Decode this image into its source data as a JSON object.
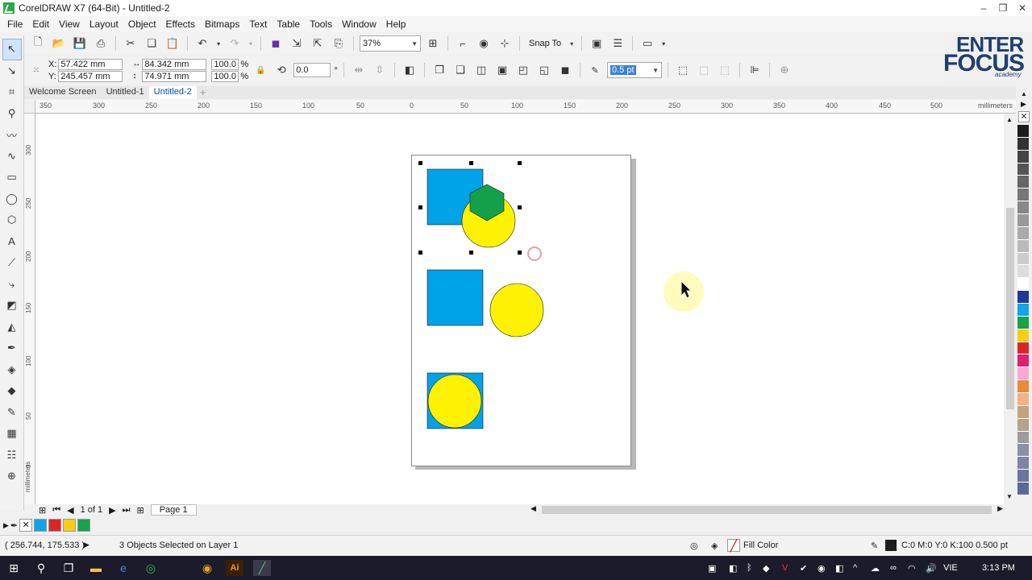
{
  "window": {
    "title": "CorelDRAW X7 (64-Bit) - Untitled-2",
    "controls": [
      "–",
      "❐",
      "✕"
    ]
  },
  "menu": [
    "File",
    "Edit",
    "View",
    "Layout",
    "Object",
    "Effects",
    "Bitmaps",
    "Text",
    "Table",
    "Tools",
    "Window",
    "Help"
  ],
  "toolbar": {
    "zoom": "37%",
    "snap_label": "Snap To"
  },
  "property_bar": {
    "x_label": "X:",
    "x_value": "57.422 mm",
    "y_label": "Y:",
    "y_value": "245.457 mm",
    "w_value": "84.342 mm",
    "h_value": "74.971 mm",
    "scale_w": "100.0",
    "scale_h": "100.0",
    "percent": "%",
    "rotation": "0.0",
    "degree": "°",
    "outline": "0.5 pt"
  },
  "logo": {
    "line1": "ENTER",
    "line2": "FOCUS",
    "line3": "academy"
  },
  "doc_tabs": [
    "Welcome Screen",
    "Untitled-1",
    "Untitled-2"
  ],
  "ruler": {
    "h_ticks": [
      "350",
      "300",
      "250",
      "200",
      "150",
      "100",
      "50",
      "0",
      "50",
      "100",
      "150",
      "200",
      "250",
      "300",
      "350",
      "400",
      "450",
      "500"
    ],
    "v_ticks": [
      "300",
      "250",
      "200",
      "150",
      "100",
      "50",
      "0"
    ],
    "unit": "millimeters"
  },
  "page_nav": {
    "counter": "1 of 1",
    "page_tab": "Page 1"
  },
  "palette_colors": [
    "#1c1c1c",
    "#333333",
    "#444444",
    "#555555",
    "#666666",
    "#777777",
    "#888888",
    "#999999",
    "#aaaaaa",
    "#bbbbbb",
    "#cccccc",
    "#dddddd",
    "#ffffff",
    "#1f3a93",
    "#0ea5e9",
    "#16a34a",
    "#facc15",
    "#dc2626",
    "#e11d74",
    "#f9a8d4",
    "#ea8a3a",
    "#f4b183",
    "#c8a27a",
    "#b5a48a",
    "#9e9aa0",
    "#8d8fa7",
    "#7d84a8",
    "#6b76a0",
    "#5a6a98"
  ],
  "doc_palette": [
    "#0ea5e9",
    "#dc2626",
    "#facc15",
    "#16a34a"
  ],
  "status": {
    "coords": "( 256.744, 175.533 )",
    "selection": "3 Objects Selected on Layer 1",
    "fill_label": "Fill Color",
    "outline_info": "C:0 M:0 Y:0 K:100  0.500 pt"
  },
  "taskbar": {
    "lang": "VIE",
    "time": "3:13 PM"
  },
  "colors": {
    "blue": "#00a2e8",
    "yellow": "#fff200",
    "green": "#14a04a"
  }
}
